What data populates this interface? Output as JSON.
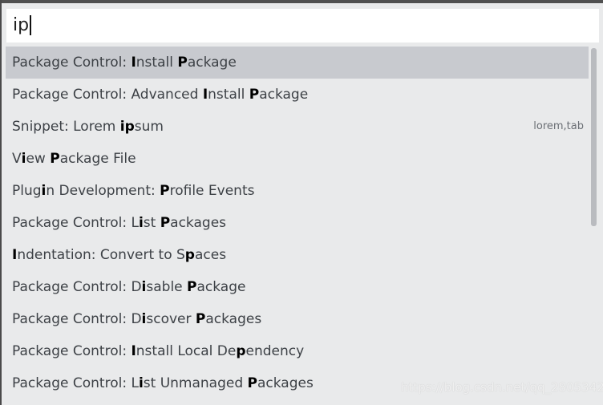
{
  "search": {
    "value": "ip"
  },
  "results": [
    {
      "segments": [
        {
          "t": "Package Control: "
        },
        {
          "t": "I",
          "m": true
        },
        {
          "t": "nstall "
        },
        {
          "t": "P",
          "m": true
        },
        {
          "t": "ackage"
        }
      ],
      "trigger": ""
    },
    {
      "segments": [
        {
          "t": "Package Control: Advanced "
        },
        {
          "t": "I",
          "m": true
        },
        {
          "t": "nstall "
        },
        {
          "t": "P",
          "m": true
        },
        {
          "t": "ackage"
        }
      ],
      "trigger": ""
    },
    {
      "segments": [
        {
          "t": "Snippet: Lorem "
        },
        {
          "t": "ip",
          "m": true
        },
        {
          "t": "sum"
        }
      ],
      "trigger": "lorem,tab"
    },
    {
      "segments": [
        {
          "t": "V"
        },
        {
          "t": "i",
          "m": true
        },
        {
          "t": "ew "
        },
        {
          "t": "P",
          "m": true
        },
        {
          "t": "ackage File"
        }
      ],
      "trigger": ""
    },
    {
      "segments": [
        {
          "t": "Plug"
        },
        {
          "t": "i",
          "m": true
        },
        {
          "t": "n Development: "
        },
        {
          "t": "P",
          "m": true
        },
        {
          "t": "rofile Events"
        }
      ],
      "trigger": ""
    },
    {
      "segments": [
        {
          "t": "Package Control: L"
        },
        {
          "t": "i",
          "m": true
        },
        {
          "t": "st "
        },
        {
          "t": "P",
          "m": true
        },
        {
          "t": "ackages"
        }
      ],
      "trigger": ""
    },
    {
      "segments": [
        {
          "t": "I",
          "m": true
        },
        {
          "t": "ndentation: Convert to S"
        },
        {
          "t": "p",
          "m": true
        },
        {
          "t": "aces"
        }
      ],
      "trigger": ""
    },
    {
      "segments": [
        {
          "t": "Package Control: D"
        },
        {
          "t": "i",
          "m": true
        },
        {
          "t": "sable "
        },
        {
          "t": "P",
          "m": true
        },
        {
          "t": "ackage"
        }
      ],
      "trigger": ""
    },
    {
      "segments": [
        {
          "t": "Package Control: D"
        },
        {
          "t": "i",
          "m": true
        },
        {
          "t": "scover "
        },
        {
          "t": "P",
          "m": true
        },
        {
          "t": "ackages"
        }
      ],
      "trigger": ""
    },
    {
      "segments": [
        {
          "t": "Package Control: "
        },
        {
          "t": "I",
          "m": true
        },
        {
          "t": "nstall Local De"
        },
        {
          "t": "p",
          "m": true
        },
        {
          "t": "endency"
        }
      ],
      "trigger": ""
    },
    {
      "segments": [
        {
          "t": "Package Control: L"
        },
        {
          "t": "i",
          "m": true
        },
        {
          "t": "st Unmanaged "
        },
        {
          "t": "P",
          "m": true
        },
        {
          "t": "ackages"
        }
      ],
      "trigger": ""
    }
  ],
  "selected_index": 0,
  "watermark": "https://blog.csdn.net/qq_28053421"
}
